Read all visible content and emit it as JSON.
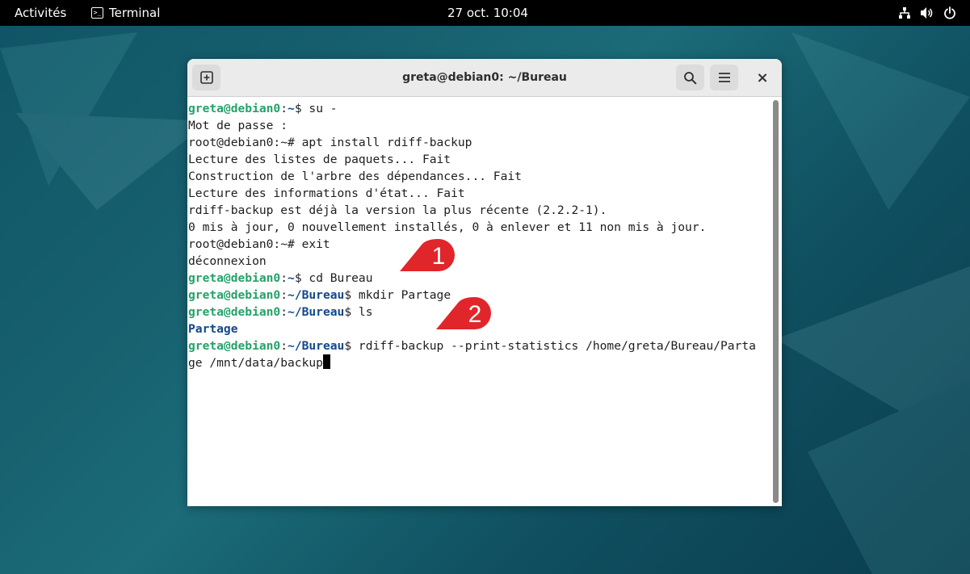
{
  "topbar": {
    "activities": "Activités",
    "app_name": "Terminal",
    "app_icon_glyph": ">_",
    "clock": "27 oct.  10:04",
    "icons": [
      "network-icon",
      "volume-icon",
      "power-icon"
    ]
  },
  "window": {
    "title": "greta@debian0: ~/Bureau",
    "buttons": [
      "new-tab-icon",
      "search-icon",
      "hamburger-menu-icon",
      "close-icon"
    ],
    "close_glyph": "×"
  },
  "terminal": {
    "lines": [
      {
        "host": "greta@debian0",
        "sep": ":",
        "path": "~",
        "sym": "$ ",
        "cmd": "su -"
      },
      {
        "text": "Mot de passe : "
      },
      {
        "text": "root@debian0:~# apt install rdiff-backup"
      },
      {
        "text": "Lecture des listes de paquets... Fait"
      },
      {
        "text": "Construction de l'arbre des dépendances... Fait"
      },
      {
        "text": "Lecture des informations d'état... Fait"
      },
      {
        "text": "rdiff-backup est déjà la version la plus récente (2.2.2-1)."
      },
      {
        "text": "0 mis à jour, 0 nouvellement installés, 0 à enlever et 11 non mis à jour."
      },
      {
        "text": "root@debian0:~# exit"
      },
      {
        "text": "déconnexion"
      },
      {
        "host": "greta@debian0",
        "sep": ":",
        "path": "~",
        "sym": "$ ",
        "cmd": "cd Bureau"
      },
      {
        "host": "greta@debian0",
        "sep": ":",
        "path": "~/Bureau",
        "sym": "$ ",
        "cmd": "mkdir Partage"
      },
      {
        "host": "greta@debian0",
        "sep": ":",
        "path": "~/Bureau",
        "sym": "$ ",
        "cmd": "ls"
      },
      {
        "dir": "Partage"
      },
      {
        "host": "greta@debian0",
        "sep": ":",
        "path": "~/Bureau",
        "sym": "$ ",
        "cmd": "rdiff-backup --print-statistics /home/greta/Bureau/Parta"
      },
      {
        "text": "ge /mnt/data/backup",
        "cursor": true
      }
    ]
  },
  "callouts": [
    {
      "label": "1",
      "color": "#e0262b"
    },
    {
      "label": "2",
      "color": "#e0262b"
    }
  ],
  "colors": {
    "prompt_host": "#26a269",
    "prompt_path": "#12488b",
    "directory": "#12488b"
  }
}
